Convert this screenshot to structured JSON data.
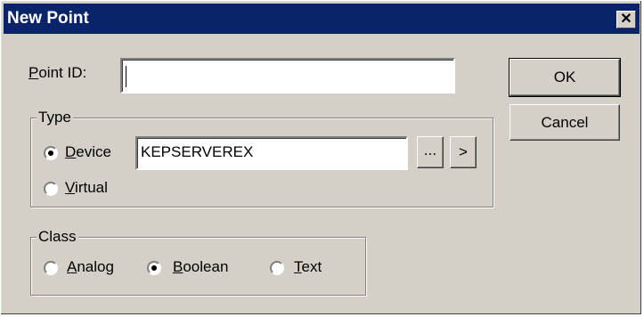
{
  "window": {
    "title": "New Point",
    "close_glyph": "✕"
  },
  "point_id": {
    "label_u": "P",
    "label_rest": "oint ID:",
    "value": ""
  },
  "buttons": {
    "ok": "OK",
    "cancel": "Cancel"
  },
  "type_group": {
    "legend": "Type",
    "device": {
      "label_u": "D",
      "label_rest": "evice",
      "selected": true
    },
    "device_value": "KEPSERVEREX",
    "browse_label": "...",
    "next_label": ">",
    "virtual": {
      "label_u": "V",
      "label_rest": "irtual",
      "selected": false
    }
  },
  "class_group": {
    "legend": "Class",
    "analog": {
      "label_u": "A",
      "label_rest": "nalog",
      "selected": false
    },
    "boolean": {
      "label_u": "B",
      "label_rest": "oolean",
      "selected": true
    },
    "text": {
      "label_u": "T",
      "label_rest": "ext",
      "selected": false
    }
  }
}
